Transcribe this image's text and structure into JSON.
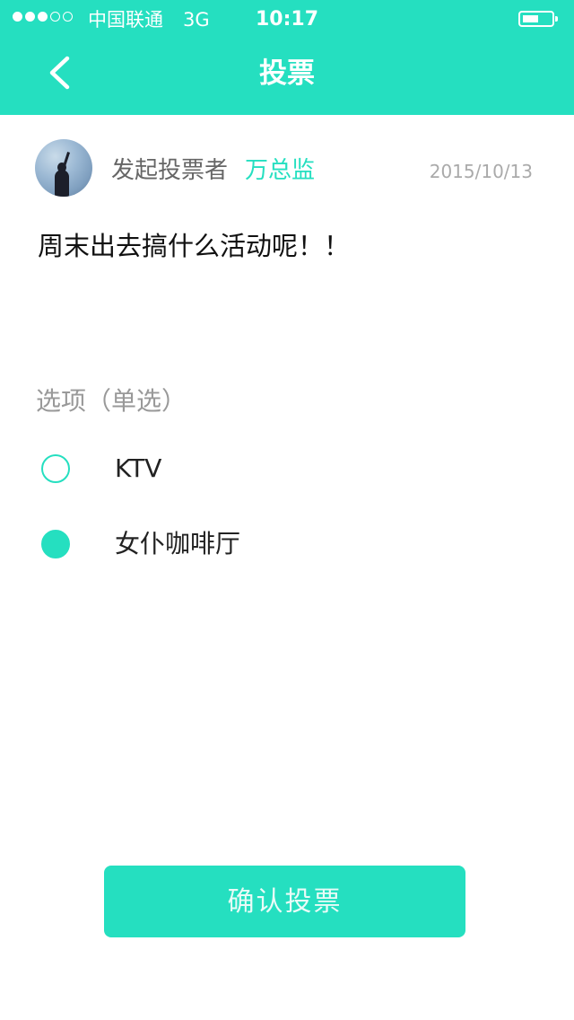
{
  "status_bar": {
    "signal_dots_filled": 3,
    "signal_dots_total": 5,
    "carrier": "中国联通",
    "network": "3G",
    "time": "10:17",
    "battery_level": 0.55
  },
  "nav": {
    "title": "投票",
    "back_icon": "chevron-left-icon"
  },
  "poll": {
    "initiator_label": "发起投票者",
    "initiator_name": "万总监",
    "date": "2015/10/13",
    "question": "周末出去搞什么活动呢！！",
    "options_label": "选项（单选）",
    "options": [
      {
        "label": "KTV",
        "selected": false
      },
      {
        "label": "女仆咖啡厅",
        "selected": true
      }
    ]
  },
  "confirm_button_label": "确认投票",
  "colors": {
    "accent": "#25dfc0",
    "text_primary": "#111111",
    "text_secondary": "#999999"
  }
}
